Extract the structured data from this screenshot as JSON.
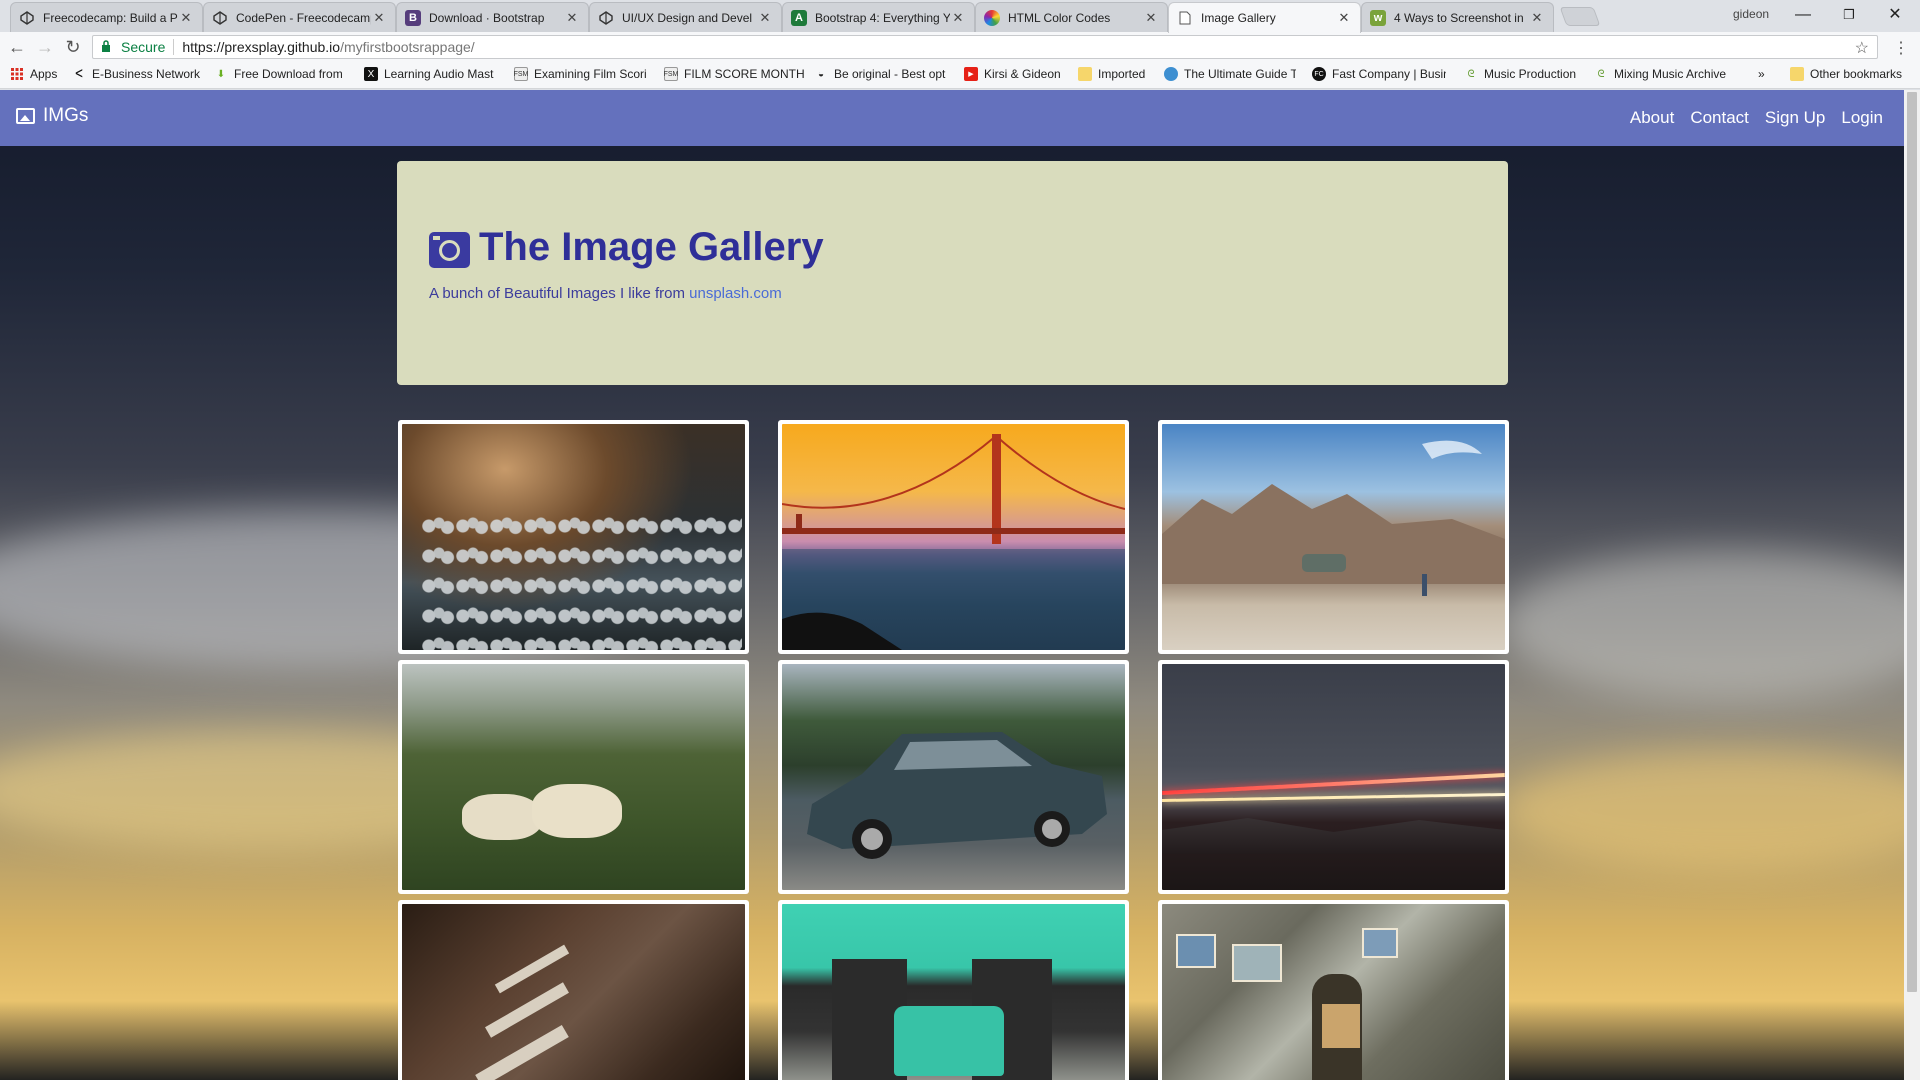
{
  "browser": {
    "tabs": [
      {
        "title": "Freecodecamp: Build a P",
        "icon": "codepen-icon"
      },
      {
        "title": "CodePen - Freecodecamp",
        "icon": "codepen-icon"
      },
      {
        "title": "Download · Bootstrap",
        "icon": "bootstrap-icon"
      },
      {
        "title": "UI/UX Design and Devel",
        "icon": "codepen-icon"
      },
      {
        "title": "Bootstrap 4: Everything Y",
        "icon": "spreadsheet-icon"
      },
      {
        "title": "HTML Color Codes",
        "icon": "color-wheel-icon"
      },
      {
        "title": "Image Gallery",
        "icon": "page-icon"
      },
      {
        "title": "4 Ways to Screenshot in",
        "icon": "wikihow-icon"
      }
    ],
    "active_tab_index": 6,
    "profile_name": "gideon",
    "secure_label": "Secure",
    "url_host": "https://prexsplay.github.io",
    "url_path": "/myfirstbootsrappage/",
    "bookmarks": [
      {
        "label": "Apps",
        "icon": "apps-grid-icon"
      },
      {
        "label": "E-Business Network",
        "icon": "ebiz-icon"
      },
      {
        "label": "Free Download from",
        "icon": "download-arrow-icon"
      },
      {
        "label": "Learning Audio Mast",
        "icon": "x-logo-icon"
      },
      {
        "label": "Examining Film Scori",
        "icon": "fsm-icon"
      },
      {
        "label": "FILM SCORE MONTH",
        "icon": "fsm-icon"
      },
      {
        "label": "Be original - Best opt",
        "icon": "mask-icon"
      },
      {
        "label": "Kirsi & Gideon",
        "icon": "youtube-icon"
      },
      {
        "label": "Imported",
        "icon": "folder-icon"
      },
      {
        "label": "The Ultimate Guide T",
        "icon": "globe-icon"
      },
      {
        "label": "Fast Company | Busin",
        "icon": "fc-icon"
      },
      {
        "label": "Music Production",
        "icon": "swirl-icon"
      },
      {
        "label": "Mixing Music Archive",
        "icon": "swirl-icon"
      }
    ],
    "bookmarks_overflow": "»",
    "other_bookmarks": "Other bookmarks"
  },
  "page": {
    "brand": "IMGs",
    "nav_links": [
      "About",
      "Contact",
      "Sign Up",
      "Login"
    ],
    "jumbotron": {
      "title": "The Image Gallery",
      "subtitle_prefix": "A bunch of Beautiful Images I like from ",
      "subtitle_link": "unsplash.com"
    },
    "gallery": [
      {
        "subject": "frosted-plants"
      },
      {
        "subject": "golden-gate-bridge"
      },
      {
        "subject": "desert-rocks-van"
      },
      {
        "subject": "sheep-in-field"
      },
      {
        "subject": "vintage-car"
      },
      {
        "subject": "light-trails"
      },
      {
        "subject": "old-desks"
      },
      {
        "subject": "teal-building-car"
      },
      {
        "subject": "painter-stone-wall"
      }
    ],
    "colors": {
      "navbar": "#6471bd",
      "jumbotron": "#d9dcbd",
      "title": "#2f2f98",
      "link": "#4a6bd6"
    }
  }
}
